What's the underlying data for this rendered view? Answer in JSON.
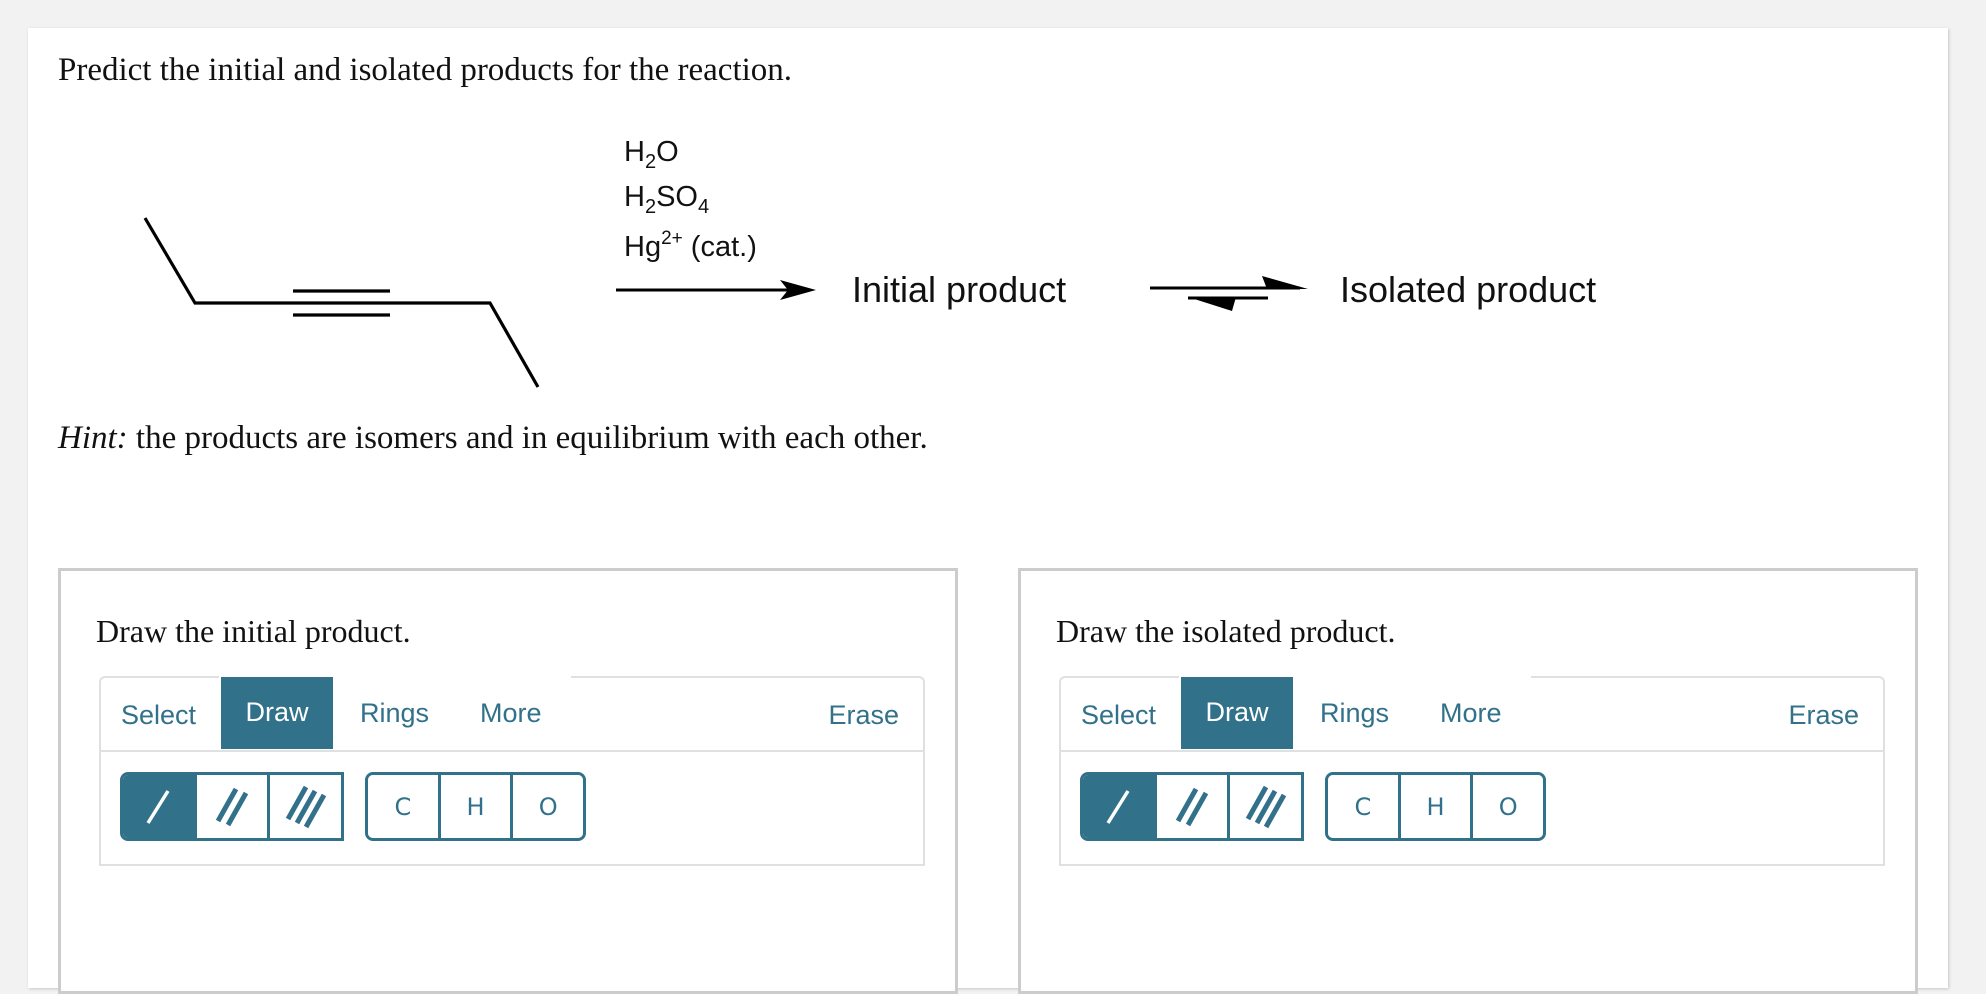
{
  "question": {
    "prompt": "Predict the initial and isolated products for the reaction.",
    "hint_label": "Hint:",
    "hint_text": " the products are isomers and in equilibrium with each other."
  },
  "reaction": {
    "reactant": "3-hexyne (skeletal structure)",
    "reagents": [
      {
        "main": "H",
        "sub": "2",
        "rest": "O"
      },
      {
        "main": "H",
        "sub": "2",
        "rest": "SO",
        "sub2": "4"
      },
      {
        "main": "Hg",
        "sup": "2+",
        "rest": " (cat.)"
      }
    ],
    "initial_product_label": "Initial product",
    "isolated_product_label": "Isolated product",
    "arrow_icon": "reaction-arrow-icon",
    "equilibrium_icon": "equilibrium-arrows-icon"
  },
  "panels": [
    {
      "title": "Draw the initial product.",
      "tabs": {
        "select": "Select",
        "draw": "Draw",
        "rings": "Rings",
        "more": "More",
        "erase": "Erase"
      },
      "active_tab": "Draw",
      "bond_tools": [
        "single-bond-icon",
        "double-bond-icon",
        "triple-bond-icon"
      ],
      "active_bond": "single-bond-icon",
      "atoms": [
        "C",
        "H",
        "O"
      ]
    },
    {
      "title": "Draw the isolated product.",
      "tabs": {
        "select": "Select",
        "draw": "Draw",
        "rings": "Rings",
        "more": "More",
        "erase": "Erase"
      },
      "active_tab": "Draw",
      "bond_tools": [
        "single-bond-icon",
        "double-bond-icon",
        "triple-bond-icon"
      ],
      "active_bond": "single-bond-icon",
      "atoms": [
        "C",
        "H",
        "O"
      ]
    }
  ],
  "colors": {
    "accent": "#31718a",
    "panel_border": "#cccccc",
    "toolbar_border": "#e0e0e0",
    "page_bg": "#f2f2f2"
  }
}
